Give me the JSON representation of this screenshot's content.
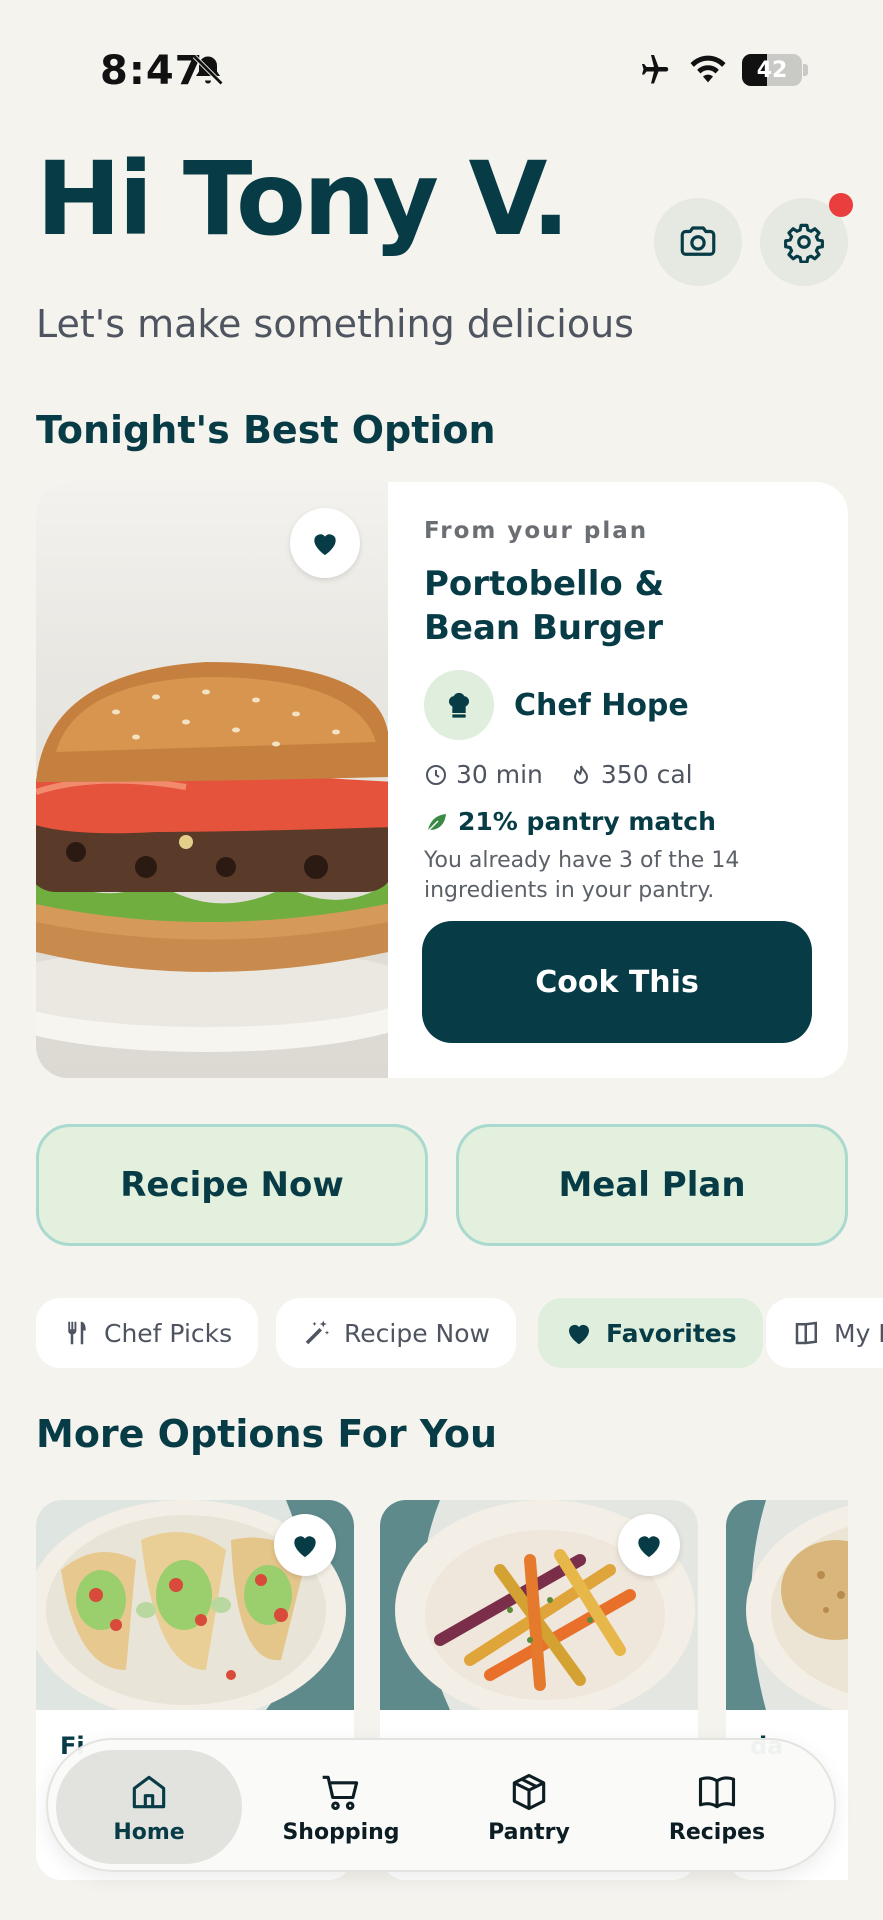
{
  "status_bar": {
    "time": "8:47",
    "battery": "42",
    "battery_level": 0.42
  },
  "header": {
    "greeting": "Hi Tony V.",
    "subtitle": "Let's make something delicious",
    "icons": [
      "camera-icon",
      "gear-icon"
    ]
  },
  "best_option": {
    "section_title": "Tonight's Best Option",
    "source": "From your plan",
    "title": "Portobello & Bean Burger",
    "chef": "Chef Hope",
    "time": "30 min",
    "calories": "350 cal",
    "pantry_match": "21% pantry match",
    "pantry_desc": "You already have 3 of the 14 ingredients in your pantry.",
    "cta": "Cook This"
  },
  "quick_actions": {
    "recipe_now": "Recipe Now",
    "meal_plan": "Meal Plan"
  },
  "chips": [
    {
      "label": "Chef Picks",
      "icon": "utensils-icon"
    },
    {
      "label": "Recipe Now",
      "icon": "magic-wand-icon"
    },
    {
      "label": "Favorites",
      "icon": "heart-icon",
      "active": true
    },
    {
      "label": "My R",
      "icon": "book-icon"
    }
  ],
  "more_options": {
    "section_title": "More Options For You",
    "cards": [
      {
        "title": "Fi"
      },
      {
        "title": ""
      },
      {
        "title": "da"
      }
    ]
  },
  "tabbar": {
    "tabs": [
      {
        "label": "Home",
        "icon": "home-icon",
        "active": true
      },
      {
        "label": "Shopping",
        "icon": "cart-icon"
      },
      {
        "label": "Pantry",
        "icon": "box-icon"
      },
      {
        "label": "Recipes",
        "icon": "book-open-icon"
      }
    ]
  },
  "colors": {
    "primary": "#073c46",
    "accent_green": "#dfeedd",
    "notification": "#ea3d3d",
    "background": "#f4f3ee"
  }
}
